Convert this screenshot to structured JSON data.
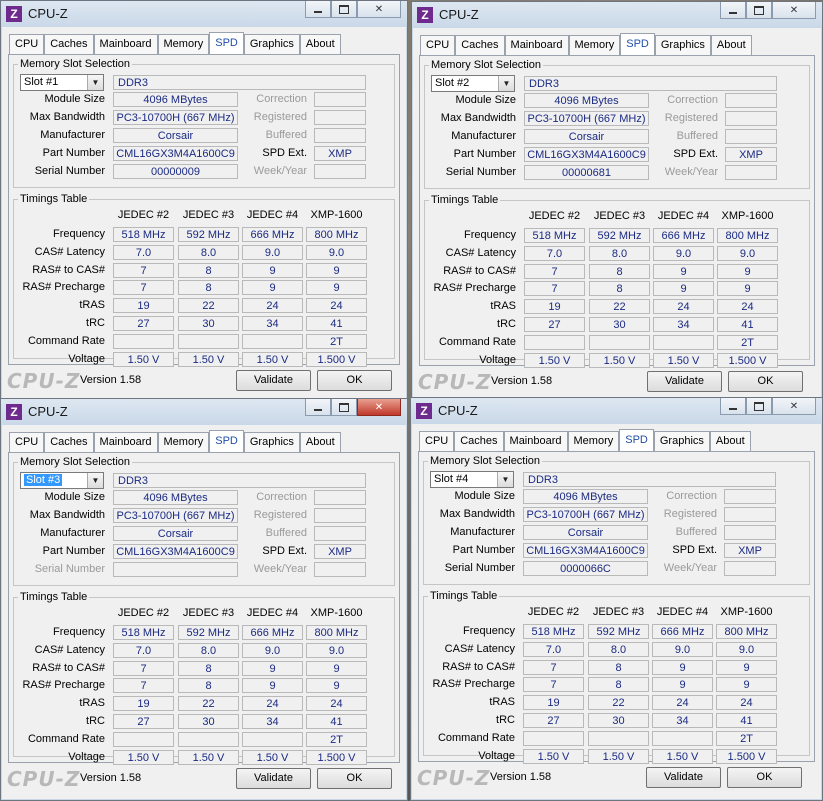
{
  "windows": [
    {
      "title": "CPU-Z",
      "active_close": false,
      "tabs": [
        "CPU",
        "Caches",
        "Mainboard",
        "Memory",
        "SPD",
        "Graphics",
        "About"
      ],
      "active_tab": "SPD",
      "memory_group_label": "Memory Slot Selection",
      "slot": {
        "value": "Slot #1",
        "highlighted": false
      },
      "memory_type": "DDR3",
      "fields": {
        "module_size": {
          "label": "Module Size",
          "value": "4096 MBytes"
        },
        "max_bandwidth": {
          "label": "Max Bandwidth",
          "value": "PC3-10700H (667 MHz)"
        },
        "manufacturer": {
          "label": "Manufacturer",
          "value": "Corsair"
        },
        "part_number": {
          "label": "Part Number",
          "value": "CML16GX3M4A1600C9"
        },
        "serial_number": {
          "label": "Serial Number",
          "value": "00000009"
        },
        "correction": {
          "label": "Correction",
          "value": ""
        },
        "registered": {
          "label": "Registered",
          "value": ""
        },
        "buffered": {
          "label": "Buffered",
          "value": ""
        },
        "spd_ext": {
          "label": "SPD Ext.",
          "value": "XMP"
        },
        "week_year": {
          "label": "Week/Year",
          "value": ""
        }
      },
      "timings_label": "Timings Table",
      "timing_columns": [
        "JEDEC #2",
        "JEDEC #3",
        "JEDEC #4",
        "XMP-1600"
      ],
      "timing_rows": [
        {
          "label": "Frequency",
          "values": [
            "518 MHz",
            "592 MHz",
            "666 MHz",
            "800 MHz"
          ]
        },
        {
          "label": "CAS# Latency",
          "values": [
            "7.0",
            "8.0",
            "9.0",
            "9.0"
          ]
        },
        {
          "label": "RAS# to CAS#",
          "values": [
            "7",
            "8",
            "9",
            "9"
          ]
        },
        {
          "label": "RAS# Precharge",
          "values": [
            "7",
            "8",
            "9",
            "9"
          ]
        },
        {
          "label": "tRAS",
          "values": [
            "19",
            "22",
            "24",
            "24"
          ]
        },
        {
          "label": "tRC",
          "values": [
            "27",
            "30",
            "34",
            "41"
          ]
        },
        {
          "label": "Command Rate",
          "values": [
            "",
            "",
            "",
            "2T"
          ]
        },
        {
          "label": "Voltage",
          "values": [
            "1.50 V",
            "1.50 V",
            "1.50 V",
            "1.500 V"
          ]
        }
      ],
      "brand": "CPU-Z",
      "version": "Version 1.58",
      "validate_label": "Validate",
      "ok_label": "OK"
    },
    {
      "title": "CPU-Z",
      "active_close": false,
      "tabs": [
        "CPU",
        "Caches",
        "Mainboard",
        "Memory",
        "SPD",
        "Graphics",
        "About"
      ],
      "active_tab": "SPD",
      "memory_group_label": "Memory Slot Selection",
      "slot": {
        "value": "Slot #2",
        "highlighted": false
      },
      "memory_type": "DDR3",
      "fields": {
        "module_size": {
          "label": "Module Size",
          "value": "4096 MBytes"
        },
        "max_bandwidth": {
          "label": "Max Bandwidth",
          "value": "PC3-10700H (667 MHz)"
        },
        "manufacturer": {
          "label": "Manufacturer",
          "value": "Corsair"
        },
        "part_number": {
          "label": "Part Number",
          "value": "CML16GX3M4A1600C9"
        },
        "serial_number": {
          "label": "Serial Number",
          "value": "00000681"
        },
        "correction": {
          "label": "Correction",
          "value": ""
        },
        "registered": {
          "label": "Registered",
          "value": ""
        },
        "buffered": {
          "label": "Buffered",
          "value": ""
        },
        "spd_ext": {
          "label": "SPD Ext.",
          "value": "XMP"
        },
        "week_year": {
          "label": "Week/Year",
          "value": ""
        }
      },
      "timings_label": "Timings Table",
      "timing_columns": [
        "JEDEC #2",
        "JEDEC #3",
        "JEDEC #4",
        "XMP-1600"
      ],
      "timing_rows": [
        {
          "label": "Frequency",
          "values": [
            "518 MHz",
            "592 MHz",
            "666 MHz",
            "800 MHz"
          ]
        },
        {
          "label": "CAS# Latency",
          "values": [
            "7.0",
            "8.0",
            "9.0",
            "9.0"
          ]
        },
        {
          "label": "RAS# to CAS#",
          "values": [
            "7",
            "8",
            "9",
            "9"
          ]
        },
        {
          "label": "RAS# Precharge",
          "values": [
            "7",
            "8",
            "9",
            "9"
          ]
        },
        {
          "label": "tRAS",
          "values": [
            "19",
            "22",
            "24",
            "24"
          ]
        },
        {
          "label": "tRC",
          "values": [
            "27",
            "30",
            "34",
            "41"
          ]
        },
        {
          "label": "Command Rate",
          "values": [
            "",
            "",
            "",
            "2T"
          ]
        },
        {
          "label": "Voltage",
          "values": [
            "1.50 V",
            "1.50 V",
            "1.50 V",
            "1.500 V"
          ]
        }
      ],
      "brand": "CPU-Z",
      "version": "Version 1.58",
      "validate_label": "Validate",
      "ok_label": "OK"
    },
    {
      "title": "CPU-Z",
      "active_close": true,
      "tabs": [
        "CPU",
        "Caches",
        "Mainboard",
        "Memory",
        "SPD",
        "Graphics",
        "About"
      ],
      "active_tab": "SPD",
      "memory_group_label": "Memory Slot Selection",
      "slot": {
        "value": "Slot #3",
        "highlighted": true
      },
      "memory_type": "DDR3",
      "fields": {
        "module_size": {
          "label": "Module Size",
          "value": "4096 MBytes"
        },
        "max_bandwidth": {
          "label": "Max Bandwidth",
          "value": "PC3-10700H (667 MHz)"
        },
        "manufacturer": {
          "label": "Manufacturer",
          "value": "Corsair"
        },
        "part_number": {
          "label": "Part Number",
          "value": "CML16GX3M4A1600C9"
        },
        "serial_number": {
          "label": "Serial Number",
          "value": ""
        },
        "correction": {
          "label": "Correction",
          "value": ""
        },
        "registered": {
          "label": "Registered",
          "value": ""
        },
        "buffered": {
          "label": "Buffered",
          "value": ""
        },
        "spd_ext": {
          "label": "SPD Ext.",
          "value": "XMP"
        },
        "week_year": {
          "label": "Week/Year",
          "value": ""
        }
      },
      "timings_label": "Timings Table",
      "timing_columns": [
        "JEDEC #2",
        "JEDEC #3",
        "JEDEC #4",
        "XMP-1600"
      ],
      "timing_rows": [
        {
          "label": "Frequency",
          "values": [
            "518 MHz",
            "592 MHz",
            "666 MHz",
            "800 MHz"
          ]
        },
        {
          "label": "CAS# Latency",
          "values": [
            "7.0",
            "8.0",
            "9.0",
            "9.0"
          ]
        },
        {
          "label": "RAS# to CAS#",
          "values": [
            "7",
            "8",
            "9",
            "9"
          ]
        },
        {
          "label": "RAS# Precharge",
          "values": [
            "7",
            "8",
            "9",
            "9"
          ]
        },
        {
          "label": "tRAS",
          "values": [
            "19",
            "22",
            "24",
            "24"
          ]
        },
        {
          "label": "tRC",
          "values": [
            "27",
            "30",
            "34",
            "41"
          ]
        },
        {
          "label": "Command Rate",
          "values": [
            "",
            "",
            "",
            "2T"
          ]
        },
        {
          "label": "Voltage",
          "values": [
            "1.50 V",
            "1.50 V",
            "1.50 V",
            "1.500 V"
          ]
        }
      ],
      "brand": "CPU-Z",
      "version": "Version 1.58",
      "validate_label": "Validate",
      "ok_label": "OK"
    },
    {
      "title": "CPU-Z",
      "active_close": false,
      "tabs": [
        "CPU",
        "Caches",
        "Mainboard",
        "Memory",
        "SPD",
        "Graphics",
        "About"
      ],
      "active_tab": "SPD",
      "memory_group_label": "Memory Slot Selection",
      "slot": {
        "value": "Slot #4",
        "highlighted": false
      },
      "memory_type": "DDR3",
      "fields": {
        "module_size": {
          "label": "Module Size",
          "value": "4096 MBytes"
        },
        "max_bandwidth": {
          "label": "Max Bandwidth",
          "value": "PC3-10700H (667 MHz)"
        },
        "manufacturer": {
          "label": "Manufacturer",
          "value": "Corsair"
        },
        "part_number": {
          "label": "Part Number",
          "value": "CML16GX3M4A1600C9"
        },
        "serial_number": {
          "label": "Serial Number",
          "value": "0000066C"
        },
        "correction": {
          "label": "Correction",
          "value": ""
        },
        "registered": {
          "label": "Registered",
          "value": ""
        },
        "buffered": {
          "label": "Buffered",
          "value": ""
        },
        "spd_ext": {
          "label": "SPD Ext.",
          "value": "XMP"
        },
        "week_year": {
          "label": "Week/Year",
          "value": ""
        }
      },
      "timings_label": "Timings Table",
      "timing_columns": [
        "JEDEC #2",
        "JEDEC #3",
        "JEDEC #4",
        "XMP-1600"
      ],
      "timing_rows": [
        {
          "label": "Frequency",
          "values": [
            "518 MHz",
            "592 MHz",
            "666 MHz",
            "800 MHz"
          ]
        },
        {
          "label": "CAS# Latency",
          "values": [
            "7.0",
            "8.0",
            "9.0",
            "9.0"
          ]
        },
        {
          "label": "RAS# to CAS#",
          "values": [
            "7",
            "8",
            "9",
            "9"
          ]
        },
        {
          "label": "RAS# Precharge",
          "values": [
            "7",
            "8",
            "9",
            "9"
          ]
        },
        {
          "label": "tRAS",
          "values": [
            "19",
            "22",
            "24",
            "24"
          ]
        },
        {
          "label": "tRC",
          "values": [
            "27",
            "30",
            "34",
            "41"
          ]
        },
        {
          "label": "Command Rate",
          "values": [
            "",
            "",
            "",
            "2T"
          ]
        },
        {
          "label": "Voltage",
          "values": [
            "1.50 V",
            "1.50 V",
            "1.50 V",
            "1.500 V"
          ]
        }
      ],
      "brand": "CPU-Z",
      "version": "Version 1.58",
      "validate_label": "Validate",
      "ok_label": "OK"
    }
  ]
}
